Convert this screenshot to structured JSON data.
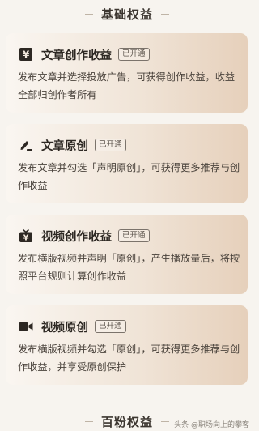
{
  "top_section": {
    "title": "基础权益"
  },
  "cards": [
    {
      "icon": "yuan-document-icon",
      "title": "文章创作收益",
      "badge": "已开通",
      "description": "发布文章并选择投放广告，可获得创作收益，收益全部归创作者所有"
    },
    {
      "icon": "pen-icon",
      "title": "文章原创",
      "badge": "已开通",
      "description": "发布文章并勾选「声明原创」，可获得更多推荐与创作收益"
    },
    {
      "icon": "tv-yuan-icon",
      "title": "视频创作收益",
      "badge": "已开通",
      "description": "发布横版视频并声明「原创」，产生播放量后，将按照平台规则计算创作收益"
    },
    {
      "icon": "video-camera-icon",
      "title": "视频原创",
      "badge": "已开通",
      "description": "发布横版视频并勾选「原创」，可获得更多推荐与创作收益，并享受原创保护"
    }
  ],
  "bottom_section": {
    "title": "百粉权益"
  },
  "watermark": "头条 @职场向上的攀客"
}
